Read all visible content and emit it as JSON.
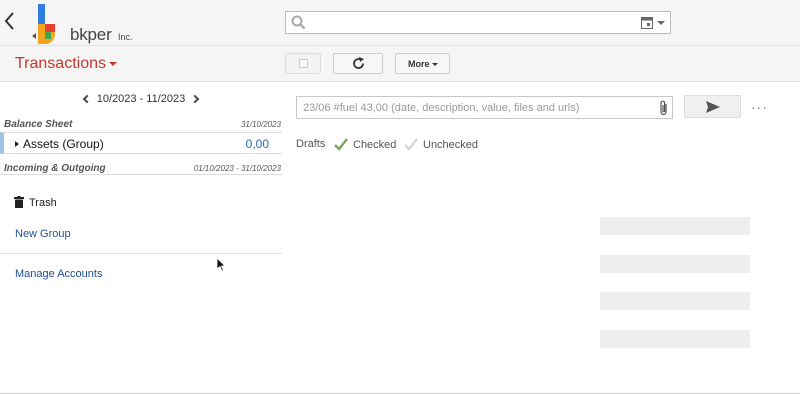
{
  "header": {
    "logo_text": "bkper",
    "logo_suffix": "Inc.",
    "search": {
      "placeholder": "",
      "value": ""
    }
  },
  "toolbar": {
    "title": "Transactions",
    "more_label": "More"
  },
  "sidebar": {
    "period": "10/2023 - 11/2023",
    "groups": [
      {
        "name": "Balance Sheet",
        "date": "31/10/2023"
      },
      {
        "name": "Incoming & Outgoing",
        "date": "01/10/2023 - 31/10/2023"
      }
    ],
    "account": {
      "name": "Assets (Group)",
      "value": "0,00"
    },
    "trash_label": "Trash",
    "new_group_label": "New Group",
    "manage_accounts_label": "Manage Accounts"
  },
  "entry": {
    "placeholder": "23/06 #fuel 43,00 (date, description, value, files and urls)",
    "more_label": "···"
  },
  "filters": {
    "drafts": "Drafts",
    "checked": "Checked",
    "unchecked": "Unchecked"
  },
  "colors": {
    "brand_red": "#c5382c",
    "link_blue": "#1f4f95",
    "checked_green": "#7aab5b"
  },
  "icons": [
    "back-icon",
    "search-icon",
    "calendar-icon",
    "refresh-icon",
    "paperclip-icon",
    "send-icon",
    "trash-icon",
    "checkmark-icon",
    "cursor-icon"
  ]
}
